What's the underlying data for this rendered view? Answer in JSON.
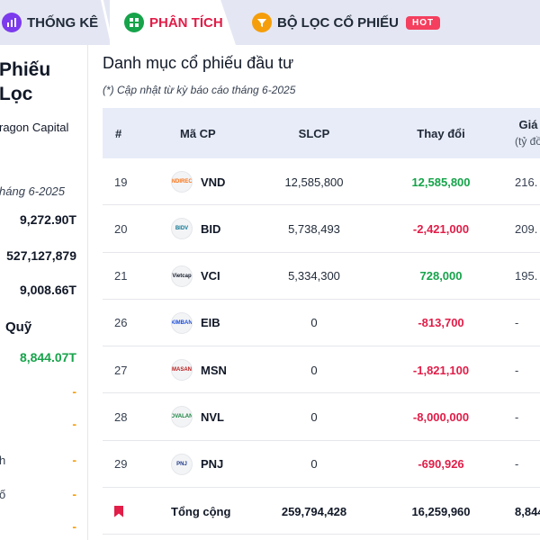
{
  "tabs": [
    {
      "label": "THỐNG KÊ",
      "icon": "bar-chart-icon"
    },
    {
      "label": "PHÂN TÍCH",
      "icon": "grid-icon"
    },
    {
      "label": "BỘ LỌC CỔ PHIẾU",
      "icon": "filter-icon",
      "badge": "HOT"
    }
  ],
  "sidebar": {
    "title_line1": "Phiếu",
    "title_line2": "Lọc",
    "subtitle": "ragon Capital",
    "update": "háng 6-2025",
    "values": [
      "9,272.90T",
      "527,127,879",
      "9,008.66T"
    ],
    "fund_label": "Quỹ",
    "fund_value": "8,844.07T",
    "dash": "-",
    "frag1": "h",
    "frag2": "ố"
  },
  "main": {
    "title": "Danh mục cổ phiếu đầu tư",
    "note": "(*) Cập nhật từ kỳ báo cáo tháng 6-2025"
  },
  "table": {
    "headers": {
      "idx": "#",
      "code": "Mã CP",
      "slcp": "SLCP",
      "change": "Thay đổi",
      "price": "Giá",
      "price_unit": "(tỷ đồ"
    },
    "rows": [
      {
        "idx": "19",
        "code": "VND",
        "logo": "VNDIRECT",
        "slcp": "12,585,800",
        "change": "12,585,800",
        "dir": "pos",
        "price": "216."
      },
      {
        "idx": "20",
        "code": "BID",
        "logo": "BIDV",
        "slcp": "5,738,493",
        "change": "-2,421,000",
        "dir": "neg",
        "price": "209."
      },
      {
        "idx": "21",
        "code": "VCI",
        "logo": "Vietcap",
        "slcp": "5,334,300",
        "change": "728,000",
        "dir": "pos",
        "price": "195."
      },
      {
        "idx": "26",
        "code": "EIB",
        "logo": "EXIMBANK",
        "slcp": "0",
        "change": "-813,700",
        "dir": "neg",
        "price": "-"
      },
      {
        "idx": "27",
        "code": "MSN",
        "logo": "MASAN",
        "slcp": "0",
        "change": "-1,821,100",
        "dir": "neg",
        "price": "-"
      },
      {
        "idx": "28",
        "code": "NVL",
        "logo": "NOVALAND",
        "slcp": "0",
        "change": "-8,000,000",
        "dir": "neg",
        "price": "-"
      },
      {
        "idx": "29",
        "code": "PNJ",
        "logo": "PNJ",
        "slcp": "0",
        "change": "-690,926",
        "dir": "neg",
        "price": "-"
      }
    ],
    "total": {
      "label": "Tổng cộng",
      "slcp": "259,794,428",
      "change": "16,259,960",
      "price": "8,844"
    }
  },
  "colors": {
    "positive": "#16a34a",
    "negative": "#e11d48",
    "accent": "#f59e0b"
  }
}
